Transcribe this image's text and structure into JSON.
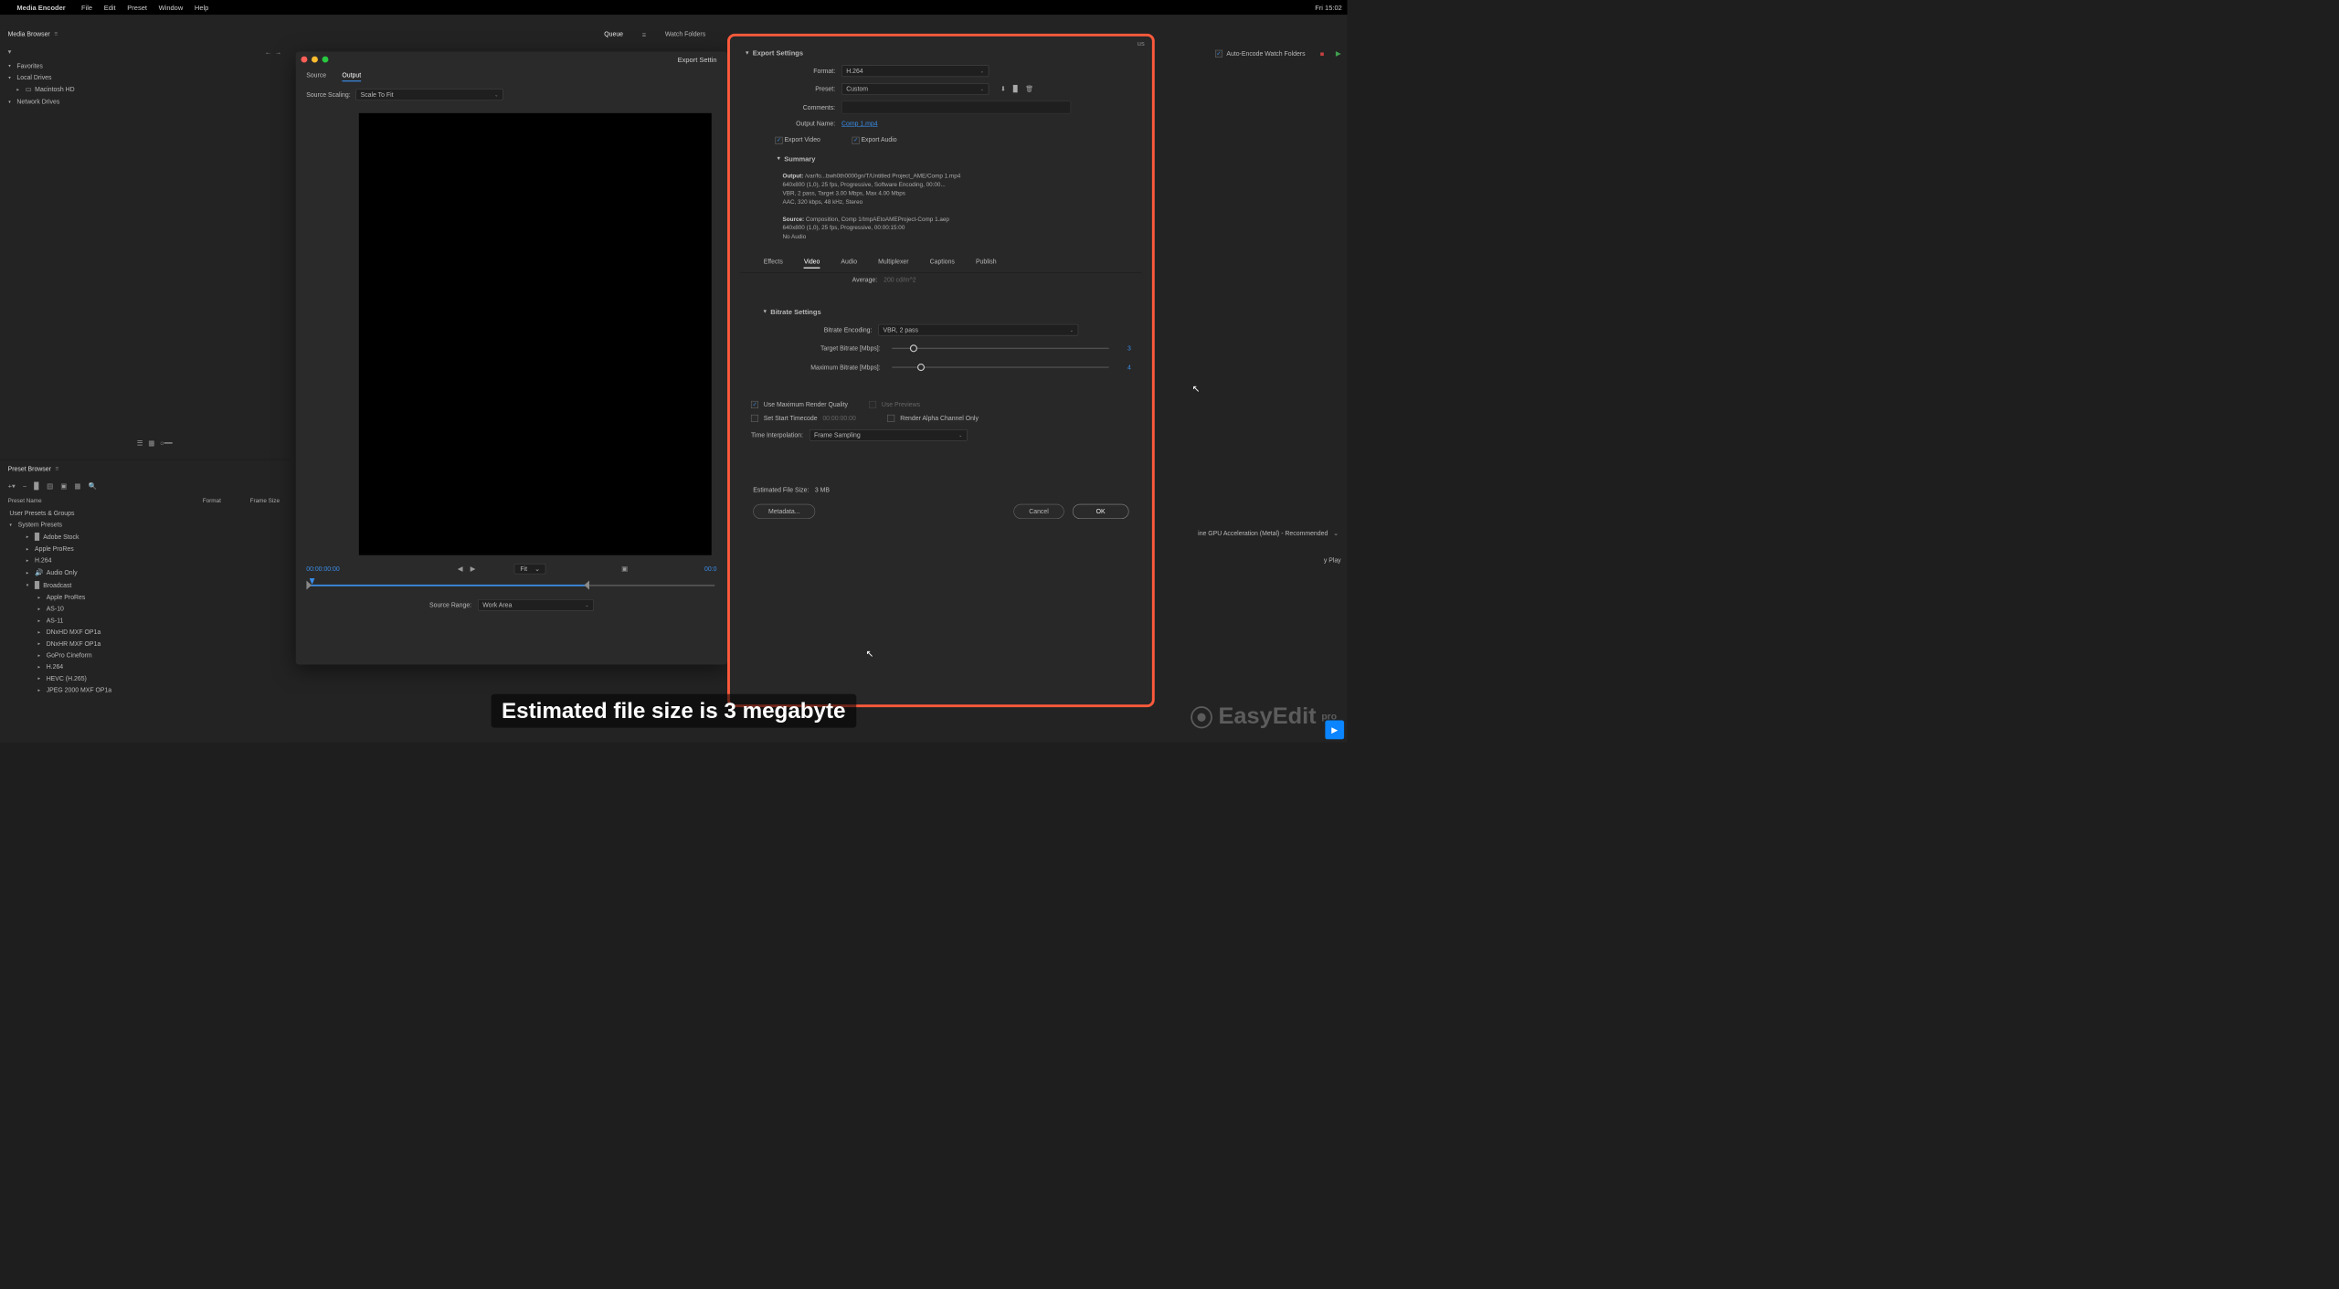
{
  "menubar": {
    "app_name": "Media Encoder",
    "items": [
      "File",
      "Edit",
      "Preset",
      "Window",
      "Help"
    ],
    "clock": "Fri 15:02"
  },
  "media_browser": {
    "title": "Media Browser",
    "favorites": "Favorites",
    "local_drives": "Local Drives",
    "macintosh_hd": "Macintosh HD",
    "network_drives": "Network Drives"
  },
  "preset_browser": {
    "title": "Preset Browser",
    "col_preset": "Preset Name",
    "col_format": "Format",
    "col_frame": "Frame Size",
    "user_presets": "User Presets & Groups",
    "system_presets": "System Presets",
    "items": [
      "Adobe Stock",
      "Apple ProRes",
      "H.264",
      "Audio Only",
      "Broadcast",
      "Apple ProRes",
      "AS-10",
      "AS-11",
      "DNxHD MXF OP1a",
      "DNxHR MXF OP1a",
      "GoPro Cineform",
      "H.264",
      "HEVC (H.265)",
      "JPEG 2000 MXF OP1a"
    ]
  },
  "queue": {
    "tab_queue": "Queue",
    "tab_watch": "Watch Folders",
    "auto_encode": "Auto-Encode Watch Folders",
    "renderer": "ine GPU Acceleration (Metal) - Recommended",
    "play": "y Play"
  },
  "export_window": {
    "title": "Export Settin",
    "tab_source": "Source",
    "tab_output": "Output",
    "source_scaling_label": "Source Scaling:",
    "source_scaling_value": "Scale To Fit",
    "timecode_start": "00:00:00:00",
    "timecode_end": "00:0",
    "fit": "Fit",
    "source_range_label": "Source Range:",
    "source_range_value": "Work Area"
  },
  "export_settings": {
    "header": "Export Settings",
    "format_label": "Format:",
    "format_value": "H.264",
    "preset_label": "Preset:",
    "preset_value": "Custom",
    "comments_label": "Comments:",
    "output_name_label": "Output Name:",
    "output_name_value": "Comp 1.mp4",
    "export_video": "Export Video",
    "export_audio": "Export Audio",
    "summary_label": "Summary",
    "summary_output_label": "Output:",
    "summary_output": "/var/fo...bwh0th0000gn/T/Untitled Project_AME/Comp 1.mp4\n640x800 (1,0), 25 fps, Progressive, Software Encoding, 00:00...\nVBR, 2 pass, Target 3.00 Mbps, Max 4.00 Mbps\nAAC, 320 kbps, 48 kHz, Stereo",
    "summary_source_label": "Source:",
    "summary_source": "Composition, Comp 1/tmpAEtoAMEProject-Comp 1.aep\n640x800 (1,0), 25 fps, Progressive, 00:00:15:00\nNo Audio",
    "tabs": [
      "Effects",
      "Video",
      "Audio",
      "Multiplexer",
      "Captions",
      "Publish"
    ],
    "average_label": "Average:",
    "average_value": "200  cd/m^2",
    "bitrate_header": "Bitrate Settings",
    "bitrate_encoding_label": "Bitrate Encoding:",
    "bitrate_encoding_value": "VBR, 2 pass",
    "target_bitrate_label": "Target Bitrate [Mbps]:",
    "target_bitrate_value": "3",
    "max_bitrate_label": "Maximum Bitrate [Mbps]:",
    "max_bitrate_value": "4",
    "use_max_render": "Use Maximum Render Quality",
    "use_previews": "Use Previews",
    "set_start_tc": "Set Start Timecode",
    "start_tc_value": "00:00:00:00",
    "render_alpha": "Render Alpha Channel Only",
    "time_interp_label": "Time Interpolation:",
    "time_interp_value": "Frame Sampling",
    "est_size_label": "Estimated File Size:",
    "est_size_value": "3 MB",
    "metadata_btn": "Metadata...",
    "cancel_btn": "Cancel",
    "ok_btn": "OK",
    "close_label": "us"
  },
  "caption": "Estimated file size is 3 megabyte",
  "watermark": {
    "name": "EasyEdit",
    "suffix": "pro"
  }
}
